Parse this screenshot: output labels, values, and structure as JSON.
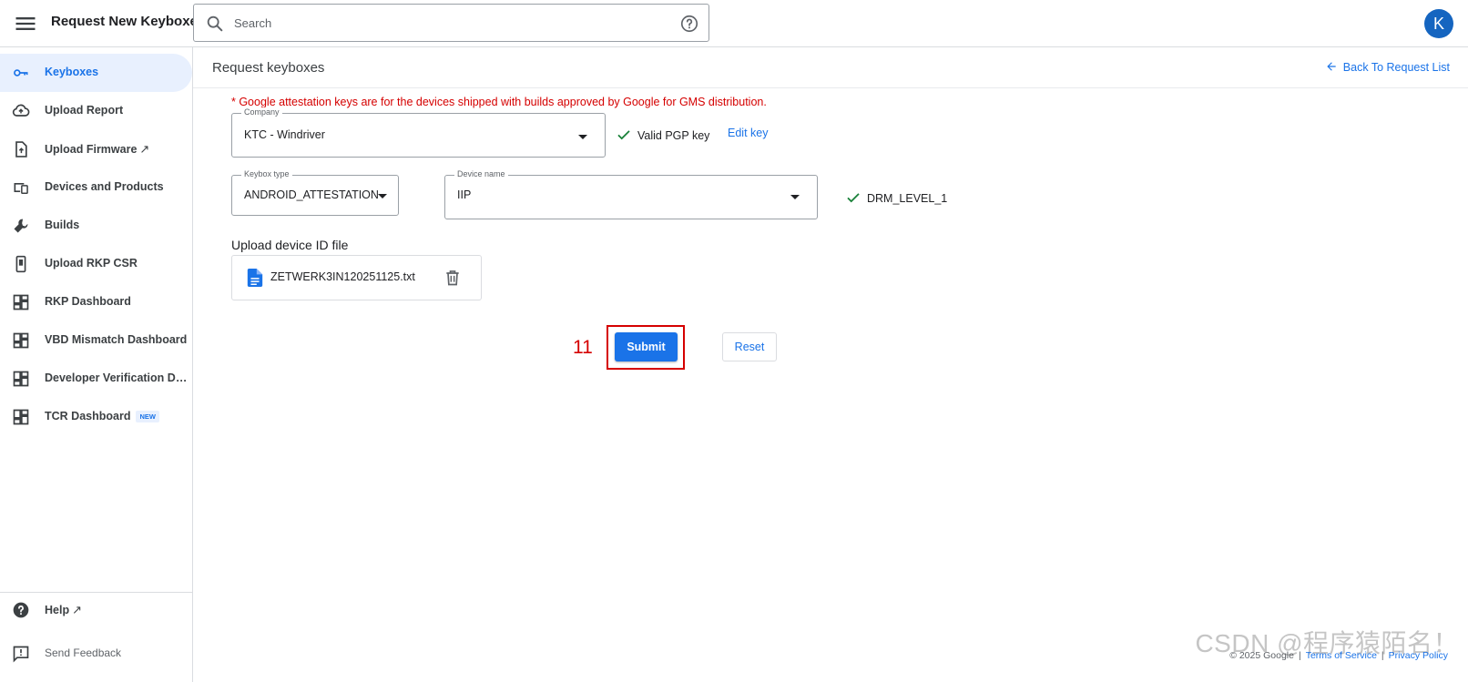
{
  "header": {
    "title": "Request New Keyboxes",
    "search_placeholder": "Search",
    "avatar_letter": "K"
  },
  "sidebar": {
    "items": [
      {
        "label": "Keyboxes",
        "icon": "key-icon",
        "active": true
      },
      {
        "label": "Upload Report",
        "icon": "cloud-upload-icon"
      },
      {
        "label": "Upload Firmware",
        "icon": "file-upload-icon",
        "external": "↗"
      },
      {
        "label": "Devices and Products",
        "icon": "devices-icon"
      },
      {
        "label": "Builds",
        "icon": "wrench-icon"
      },
      {
        "label": "Upload RKP CSR",
        "icon": "phone-icon"
      },
      {
        "label": "RKP Dashboard",
        "icon": "dashboard-icon"
      },
      {
        "label": "VBD Mismatch Dashboard",
        "icon": "dashboard-icon"
      },
      {
        "label": "Developer Verification Das...",
        "icon": "dashboard-icon"
      },
      {
        "label": "TCR Dashboard",
        "icon": "dashboard-icon",
        "badge": "NEW"
      }
    ],
    "help": {
      "label": "Help",
      "external": "↗",
      "icon": "help-circle-icon"
    },
    "feedback": {
      "label": "Send Feedback",
      "icon": "feedback-icon"
    }
  },
  "main": {
    "page_title": "Request keyboxes",
    "back_link": "Back To Request List",
    "notice": "* Google attestation keys are for the devices shipped with builds approved by Google for GMS distribution.",
    "company": {
      "label": "Company",
      "value": "KTC - Windriver"
    },
    "pgp_status": "Valid PGP key",
    "edit_key": "Edit key",
    "keybox_type": {
      "label": "Keybox type",
      "value": "ANDROID_ATTESTATION"
    },
    "device_name": {
      "label": "Device name",
      "value": "IIP"
    },
    "drm_level": "DRM_LEVEL_1",
    "upload_heading": "Upload device ID file",
    "file_name": "ZETWERK3IN120251125.txt",
    "step_number": "11",
    "submit_label": "Submit",
    "reset_label": "Reset"
  },
  "footer": {
    "copyright": "© 2025 Google",
    "terms": "Terms of Service",
    "privacy": "Privacy Policy"
  },
  "watermark": "CSDN @程序猿陌名！",
  "colors": {
    "accent": "#1a73e8",
    "warning_red": "#d50000",
    "success_green": "#188038",
    "active_nav_bg": "#e8f0fe",
    "avatar_bg": "#1565c0"
  }
}
